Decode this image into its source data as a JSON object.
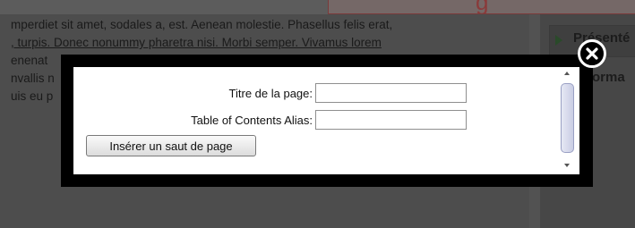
{
  "background_page": {
    "article_lines": [
      "mperdiet sit amet, sodales a, est. Aenean molestie. Phasellus felis erat,",
      ", turpis. Donec nonummy pharetra nisi. Morbi semper. Vivamus lorem",
      "enenat",
      "nvallis n",
      "uis eu p"
    ],
    "sidebar_label_1": "Présenté",
    "sidebar_label_2": "orma",
    "top_tab_text": "g"
  },
  "modal": {
    "fields": [
      {
        "label": "Titre de la page:",
        "value": "",
        "placeholder": ""
      },
      {
        "label": "Table of Contents Alias:",
        "value": "",
        "placeholder": ""
      }
    ],
    "insert_button_label": "Insérer un saut de page",
    "close_icon": "close-x-icon"
  },
  "colors": {
    "overlay_frame": "#000000",
    "modal_body": "#ffffff",
    "scroll_thumb": "#c9cde4"
  }
}
